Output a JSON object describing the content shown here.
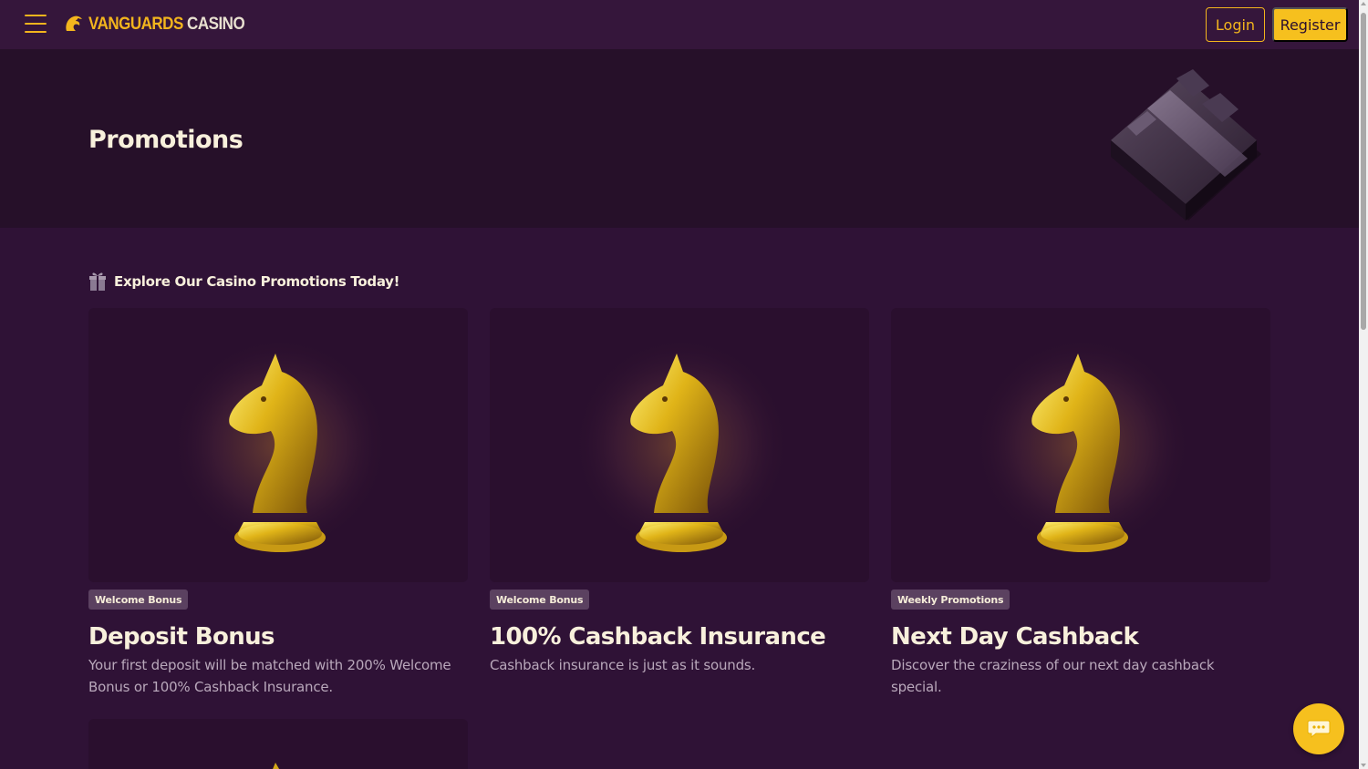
{
  "header": {
    "logo_brand": "VANGUARDS",
    "logo_suffix": "CASINO",
    "login_label": "Login",
    "register_label": "Register",
    "menu_icon": "hamburger-icon"
  },
  "hero": {
    "title": "Promotions",
    "image_icon": "gift-box-icon"
  },
  "promotions": {
    "section_title": "Explore Our Casino Promotions Today!",
    "section_icon": "gift-icon",
    "cards": [
      {
        "tag": "Welcome Bonus",
        "title": "Deposit Bonus",
        "description": "Your first deposit will be matched with 200% Welcome Bonus or 100% Cashback Insurance."
      },
      {
        "tag": "Welcome Bonus",
        "title": "100% Cashback Insurance",
        "description": "Cashback insurance is just as it sounds."
      },
      {
        "tag": "Weekly Promotions",
        "title": "Next Day Cashback",
        "description": "Discover the craziness of our next day cashback special."
      }
    ]
  },
  "chat": {
    "icon": "chat-bubble-icon"
  },
  "colors": {
    "accent": "#f6c01e",
    "background": "#2f1236",
    "hero_background": "#261029",
    "tag_background": "#5b4160"
  }
}
